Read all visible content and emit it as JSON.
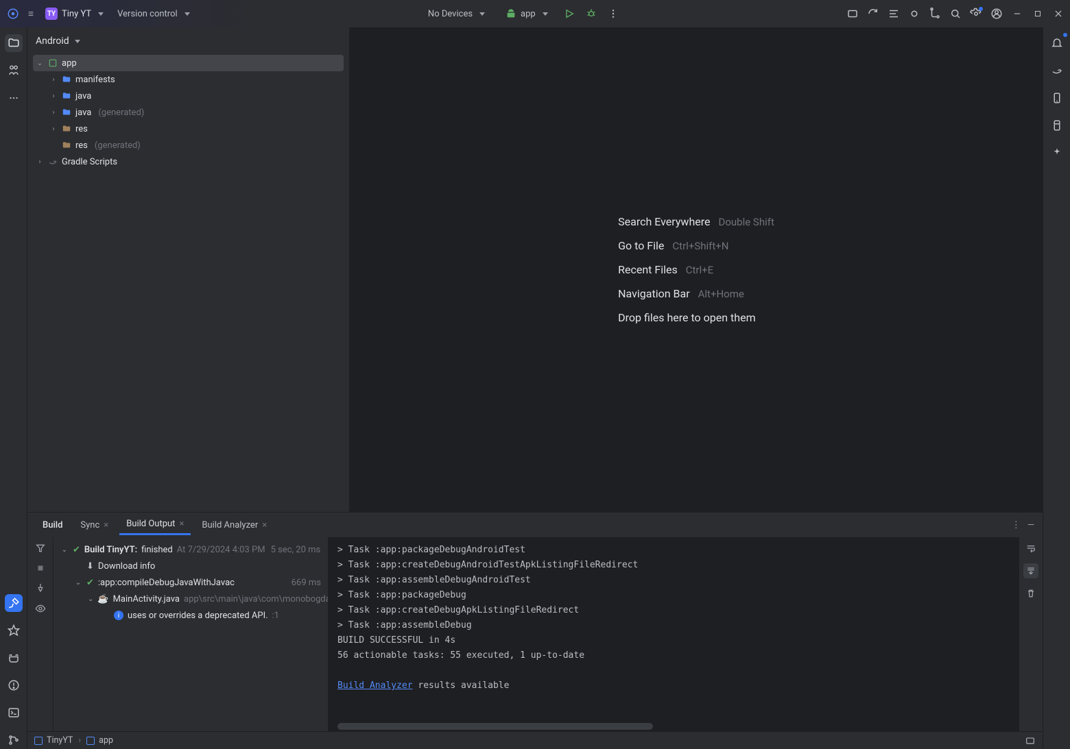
{
  "titlebar": {
    "project_initials": "TY",
    "project_name": "Tiny YT",
    "vcs_label": "Version control",
    "device": "No Devices",
    "run_config": "app"
  },
  "project_panel": {
    "view": "Android",
    "tree": {
      "app": "app",
      "manifests": "manifests",
      "java": "java",
      "java_gen_prefix": "java",
      "java_gen_suffix": "(generated)",
      "res": "res",
      "res_gen_prefix": "res",
      "res_gen_suffix": "(generated)",
      "gradle": "Gradle Scripts"
    }
  },
  "editor_hints": {
    "r0_lbl": "Search Everywhere",
    "r0_key": "Double Shift",
    "r1_lbl": "Go to File",
    "r1_key": "Ctrl+Shift+N",
    "r2_lbl": "Recent Files",
    "r2_key": "Ctrl+E",
    "r3_lbl": "Navigation Bar",
    "r3_key": "Alt+Home",
    "r4_lbl": "Drop files here to open them"
  },
  "build": {
    "tab_title": "Build",
    "tab_sync": "Sync",
    "tab_output": "Build Output",
    "tab_analyzer": "Build Analyzer",
    "tree": {
      "root_pre": "Build TinyYT:",
      "root_status": "finished",
      "root_time": "At 7/29/2024 4:03 PM",
      "root_dur": "5 sec, 20 ms",
      "download": "Download info",
      "compile": ":app:compileDebugJavaWithJavac",
      "compile_ms": "669 ms",
      "file": "MainActivity.java",
      "file_path": "app\\src\\main\\java\\com\\monobogda",
      "warn": "uses or overrides a deprecated API.",
      "warn_n": ":1"
    },
    "console_lines": [
      "> Task :app:packageDebugAndroidTest",
      "> Task :app:createDebugAndroidTestApkListingFileRedirect",
      "> Task :app:assembleDebugAndroidTest",
      "> Task :app:packageDebug",
      "> Task :app:createDebugApkListingFileRedirect",
      "> Task :app:assembleDebug",
      "",
      "BUILD SUCCESSFUL in 4s",
      "56 actionable tasks: 55 executed, 1 up-to-date"
    ],
    "analyzer_link": "Build Analyzer",
    "analyzer_tail": " results available"
  },
  "statusbar": {
    "crumb0": "TinyYT",
    "crumb1": "app"
  }
}
